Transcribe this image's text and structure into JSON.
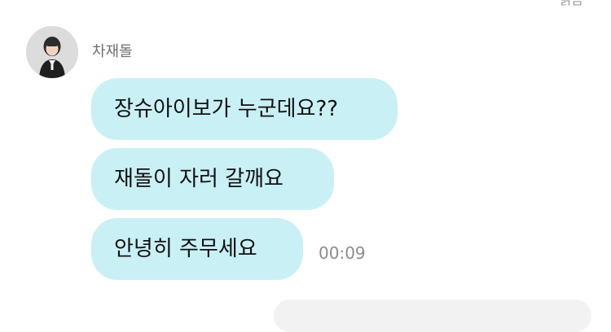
{
  "header": {
    "read_label": "읽음"
  },
  "sender": {
    "name": "차재돌",
    "avatar_icon": "profile-photo"
  },
  "messages": [
    {
      "text": "장슈아이보가 누군데요??"
    },
    {
      "text": "재돌이 자러 갈깨요"
    },
    {
      "text": "안녕히 주무세요",
      "time": "00:09"
    }
  ],
  "colors": {
    "incoming_bubble": "#c9f0f5",
    "timestamp": "#8c8c8c"
  }
}
